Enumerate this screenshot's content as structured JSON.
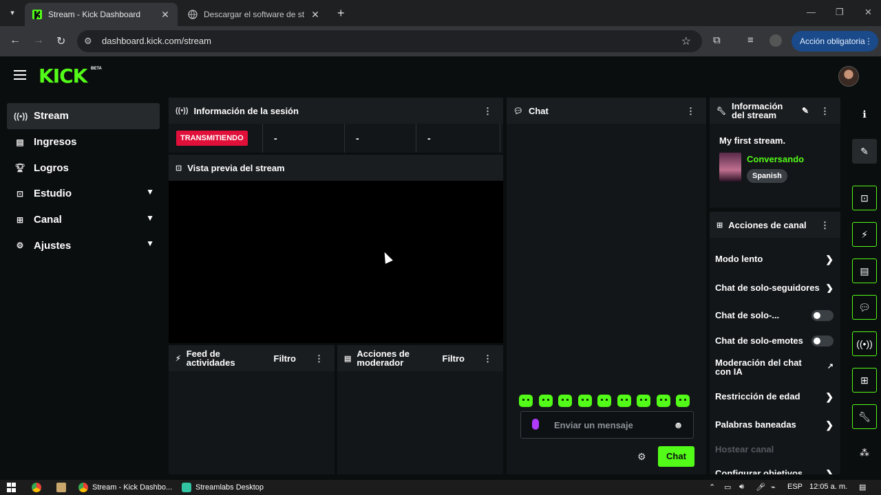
{
  "browser": {
    "tabs": [
      {
        "title": "Stream - Kick Dashboard",
        "favicon": "kick-favicon"
      },
      {
        "title": "Descargar el software de strea",
        "favicon": "globe-icon"
      }
    ],
    "url": "dashboard.kick.com/stream",
    "action_button": "Acción obligatoria"
  },
  "app": {
    "logo": "KICK",
    "logo_badge": "BETA",
    "accent": "#53fc18"
  },
  "sidebar": {
    "items": [
      {
        "label": "Stream",
        "icon": "stream-icon",
        "active": true
      },
      {
        "label": "Ingresos",
        "icon": "revenue-icon"
      },
      {
        "label": "Logros",
        "icon": "trophy-icon"
      },
      {
        "label": "Estudio",
        "icon": "studio-icon",
        "expandable": true
      },
      {
        "label": "Canal",
        "icon": "channel-icon",
        "expandable": true
      },
      {
        "label": "Ajustes",
        "icon": "gear-icon",
        "expandable": true
      }
    ]
  },
  "session": {
    "title": "Información de la sesión",
    "status": "TRANSMITIENDO",
    "stats": [
      "-",
      "-",
      "-"
    ]
  },
  "preview": {
    "title": "Vista previa del stream"
  },
  "activity": {
    "title_line1": "Feed de",
    "title_line2": "actividades",
    "filter": "Filtro"
  },
  "modactions": {
    "title_line1": "Acciones de",
    "title_line2": "moderador",
    "filter": "Filtro"
  },
  "chat": {
    "title": "Chat",
    "placeholder": "Enviar un mensaje",
    "send": "Chat",
    "emote_count": 9
  },
  "stream_info": {
    "title_line1": "Información",
    "title_line2": "del stream",
    "stream_title": "My first stream.",
    "category": "Conversando",
    "language": "Spanish"
  },
  "channel_actions": {
    "title": "Acciones de canal",
    "items": [
      {
        "label": "Modo lento",
        "control": "arrow"
      },
      {
        "label": "Chat de solo-seguidores",
        "control": "arrow"
      },
      {
        "label": "Chat de solo-...",
        "control": "toggle"
      },
      {
        "label": "Chat de solo-emotes",
        "control": "toggle"
      },
      {
        "label": "Moderación del chat",
        "label2": "con IA",
        "control": "external"
      },
      {
        "label": "Restricción de edad",
        "control": "arrow"
      },
      {
        "label": "Palabras baneadas",
        "control": "arrow"
      },
      {
        "label": "Hostear canal",
        "control": "none",
        "disabled": true
      },
      {
        "label": "Configurar objetivos",
        "control": "arrow"
      }
    ]
  },
  "taskbar": {
    "apps": [
      {
        "label": "Stream - Kick Dashbo..."
      },
      {
        "label": "Streamlabs Desktop"
      }
    ],
    "lang": "ESP",
    "time": "12:05 a. m."
  }
}
